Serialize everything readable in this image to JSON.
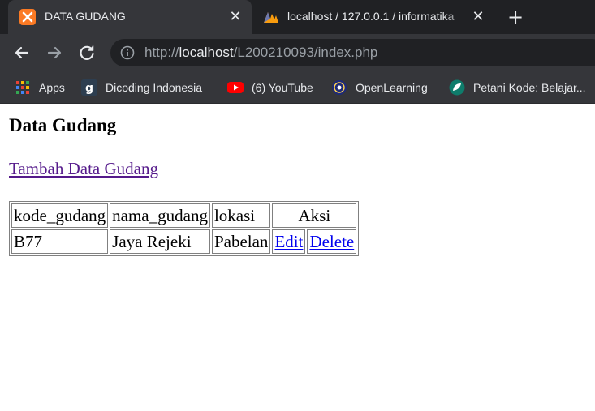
{
  "browser": {
    "tabs": [
      {
        "title": "DATA GUDANG",
        "active": true,
        "icon": "xampp-icon"
      },
      {
        "title": "localhost / 127.0.0.1 / informatika",
        "active": false,
        "icon": "phpmyadmin-icon"
      }
    ],
    "address_bar": {
      "scheme": "http://",
      "host": "localhost",
      "path": "/L200210093/index.php"
    },
    "bookmarks": [
      {
        "label": "Apps",
        "icon": "apps-grid-icon"
      },
      {
        "label": "Dicoding Indonesia",
        "icon": "dicoding-icon"
      },
      {
        "label": "(6) YouTube",
        "icon": "youtube-icon"
      },
      {
        "label": "OpenLearning",
        "icon": "openlearning-icon"
      },
      {
        "label": "Petani Kode: Belajar...",
        "icon": "petanikode-icon"
      }
    ],
    "colors": {
      "chrome_dark": "#202124",
      "chrome_toolbar": "#35363a",
      "text": "#e8eaed"
    }
  },
  "page": {
    "heading": "Data Gudang",
    "add_link": "Tambah Data Gudang",
    "table": {
      "headers": [
        "kode_gudang",
        "nama_gudang",
        "lokasi",
        "Aksi"
      ],
      "rows": [
        {
          "kode_gudang": "B77",
          "nama_gudang": "Jaya Rejeki",
          "lokasi": "Pabelan",
          "edit": "Edit",
          "delete": "Delete"
        }
      ]
    },
    "colors": {
      "link": "#0000ee",
      "visited_link": "#551a8b"
    }
  }
}
